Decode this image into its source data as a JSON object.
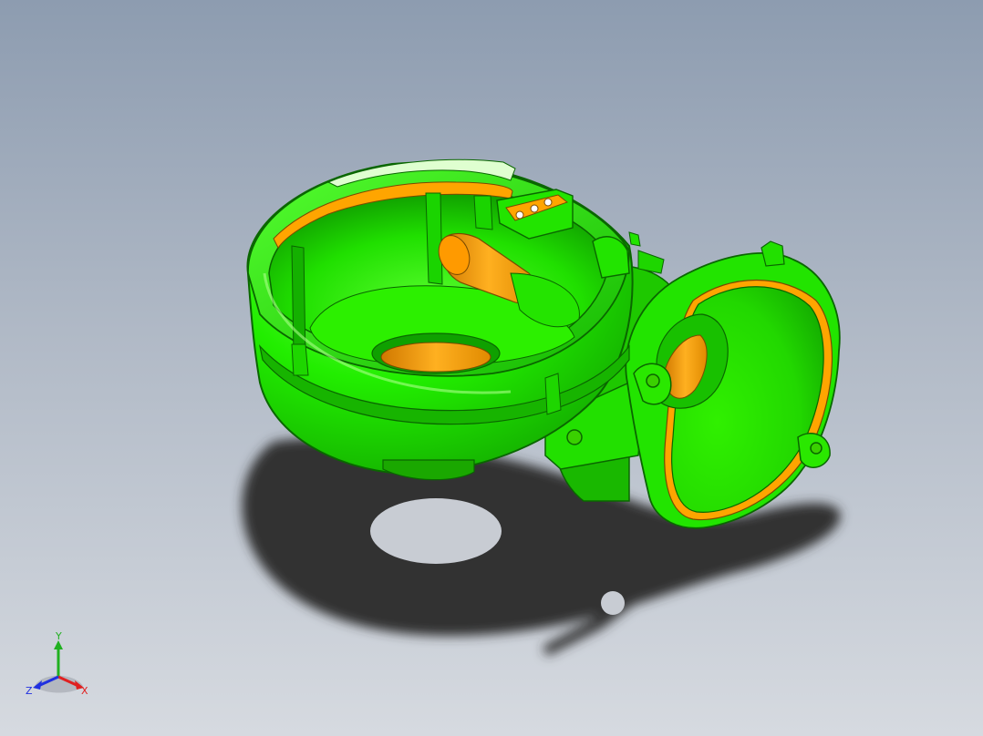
{
  "viewport": {
    "background_top": "#8d9cb0",
    "background_bottom": "#d6dae0"
  },
  "model": {
    "body_color": "#22ee00",
    "body_shade": "#12a800",
    "highlight_color": "#aaff88",
    "machined_color": "#ffa500",
    "machined_shade": "#d07800",
    "shadow_color": "#303030"
  },
  "triad": {
    "x_label": "X",
    "y_label": "Y",
    "z_label": "Z",
    "x_color": "#e02020",
    "y_color": "#20b020",
    "z_color": "#2030e0"
  }
}
